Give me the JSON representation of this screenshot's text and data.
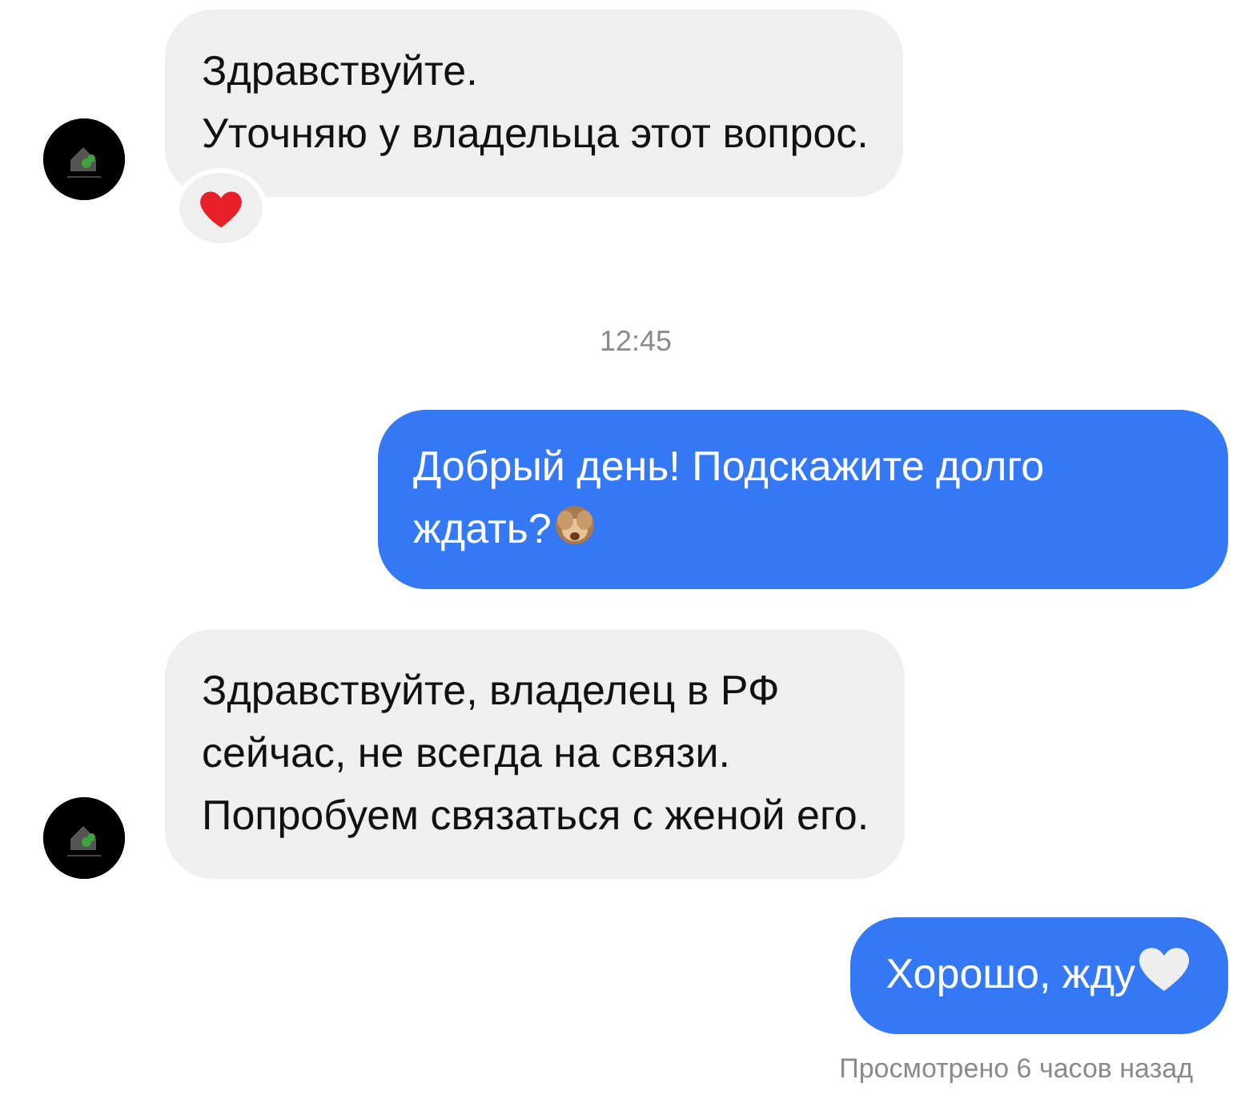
{
  "messages": [
    {
      "kind": "incoming",
      "text": "Здравствуйте.\nУточняю у владельца этот вопрос.",
      "reacted": true
    },
    {
      "kind": "time",
      "text": "12:45"
    },
    {
      "kind": "outgoing",
      "text": "Добрый день! Подскажите долго ждать?",
      "emoji": {
        "kind": "monkey"
      }
    },
    {
      "kind": "incoming",
      "text": "Здравствуйте, владелец в РФ\nсейчас, не всегда на связи.\nПопробуем связаться с женой его.",
      "reacted": false
    },
    {
      "kind": "outgoing",
      "text": "Хорошо, жду",
      "emoji": {
        "kind": "heart"
      }
    }
  ],
  "seen_status": "Просмотрено 6 часов назад"
}
